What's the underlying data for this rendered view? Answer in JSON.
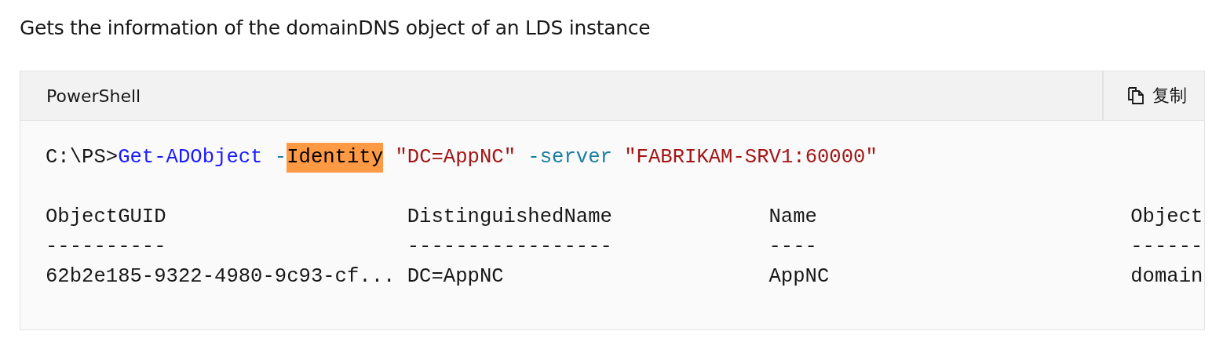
{
  "description": "Gets the information of the domainDNS object of an LDS instance",
  "code_block": {
    "language": "PowerShell",
    "copy_label": "复制",
    "command": [
      {
        "text": "C:\\PS>",
        "kind": "prompt"
      },
      {
        "text": "Get-ADObject",
        "kind": "cmdlet"
      },
      {
        "text": " -",
        "kind": "parameter"
      },
      {
        "text": "Identity",
        "kind": "highlight"
      },
      {
        "text": " \"DC=AppNC\"",
        "kind": "string"
      },
      {
        "text": " -server",
        "kind": "parameter"
      },
      {
        "text": " \"FABRIKAM-SRV1:60000\"",
        "kind": "string"
      }
    ],
    "output": {
      "columns": [
        "ObjectGUID",
        "DistinguishedName",
        "Name",
        "Object"
      ],
      "separators": [
        "----------",
        "-----------------",
        "----",
        "------"
      ],
      "rows": [
        [
          "62b2e185-9322-4980-9c93-cf...",
          "DC=AppNC",
          "AppNC",
          "domain"
        ]
      ]
    }
  }
}
